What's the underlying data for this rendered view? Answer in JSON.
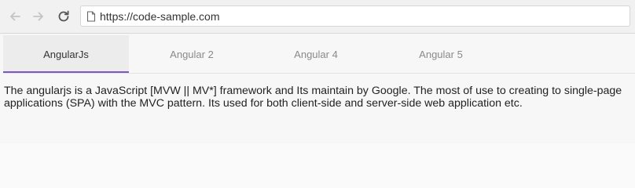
{
  "browser": {
    "url": "https://code-sample.com",
    "icons": [
      "back-arrow-icon",
      "forward-arrow-icon",
      "reload-icon",
      "page-icon"
    ]
  },
  "tabs": [
    {
      "label": "AngularJs",
      "active": true
    },
    {
      "label": "Angular 2",
      "active": false
    },
    {
      "label": "Angular 4",
      "active": false
    },
    {
      "label": "Angular 5",
      "active": false
    }
  ],
  "content": {
    "description": "The angularjs is a JavaScript [MVW || MV*] framework and Its maintain by Google. The most of use to creating to single-page applications (SPA) with the MVC pattern. Its used for both client-side and server-side web application etc."
  },
  "colors": {
    "active_tab_indicator": "#7e57c2",
    "active_tab_bg": "#ececec",
    "inactive_tab_text": "#8a8a8a"
  }
}
